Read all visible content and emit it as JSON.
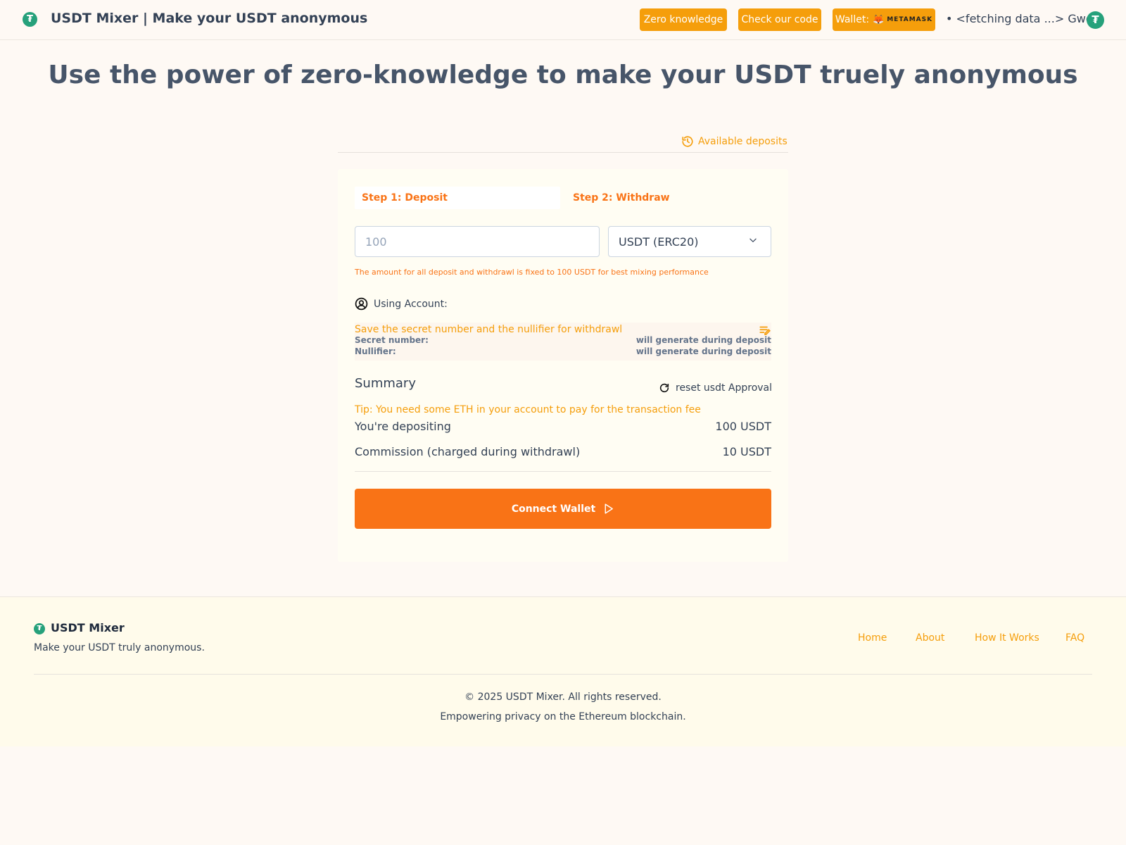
{
  "header": {
    "brand": "USDT Mixer | Make your USDT anonymous",
    "zero_knowledge_label": "Zero knowledge",
    "check_code_label": "Check our code",
    "wallet_label": "Wallet:",
    "wallet_provider": "METAMASK",
    "gas_price": "• <fetching data ...> Gwei"
  },
  "hero": {
    "title": "Use the power of zero-knowledge to make your USDT truely anonymous"
  },
  "deposits": {
    "link_label": "Available deposits"
  },
  "tabs": [
    {
      "label": "Step 1: Deposit",
      "active": true
    },
    {
      "label": "Step 2: Withdraw",
      "active": false
    }
  ],
  "form": {
    "amount_placeholder": "100",
    "token_selected": "USDT (ERC20)",
    "hint": "The amount for all deposit and withdrawl is fixed to 100 USDT for best mixing performance",
    "account_label": "Using Account:"
  },
  "secrets": {
    "title": "Save the secret number and the nullifier for withdrawl",
    "secret_label": "Secret number:",
    "secret_value": "will generate during deposit",
    "nullifier_label": "Nullifier:",
    "nullifier_value": "will generate during deposit"
  },
  "summary": {
    "title": "Summary",
    "reset_label": "reset usdt Approval",
    "tip": "Tip: You need some ETH in your account to pay for the transaction fee",
    "rows": [
      {
        "label": "You're depositing",
        "value": "100 USDT"
      },
      {
        "label": "Commission (charged during withdrawl)",
        "value": "10 USDT"
      }
    ],
    "connect_label": "Connect Wallet"
  },
  "footer": {
    "name": "USDT Mixer",
    "tagline": "Make your USDT truly anonymous.",
    "links": [
      "Home",
      "About",
      "How It Works",
      "FAQ"
    ],
    "copyright": "© 2025 USDT Mixer. All rights reserved.",
    "empower": "Empowering privacy on the Ethereum blockchain."
  },
  "colors": {
    "accent": "#f97316",
    "amber": "#f59e0b",
    "tether": "#26a17b",
    "background": "#fef9f4"
  }
}
